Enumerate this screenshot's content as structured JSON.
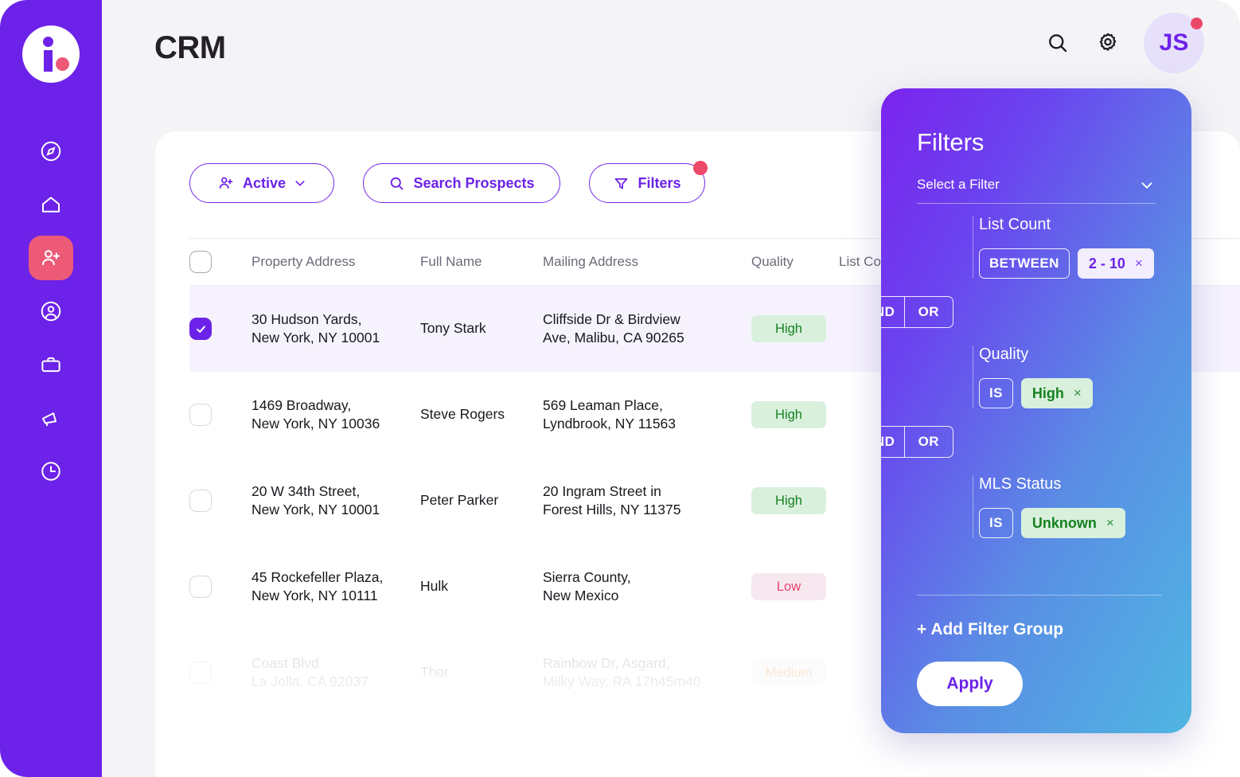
{
  "app": {
    "logo_name": "company-logo",
    "brand_purple": "#6c22e8",
    "accent_pink": "#ec4868"
  },
  "sidebar": {
    "items": [
      {
        "icon": "compass-icon",
        "label": "Explore",
        "active": false
      },
      {
        "icon": "home-icon",
        "label": "Home",
        "active": false
      },
      {
        "icon": "add-user-icon",
        "label": "Prospects",
        "active": true
      },
      {
        "icon": "user-circle-icon",
        "label": "Contacts",
        "active": false
      },
      {
        "icon": "briefcase-icon",
        "label": "Deals",
        "active": false
      },
      {
        "icon": "megaphone-icon",
        "label": "Campaigns",
        "active": false
      },
      {
        "icon": "clock-icon",
        "label": "Activity",
        "active": false
      }
    ]
  },
  "header": {
    "title": "CRM",
    "search_icon": "search-icon",
    "settings_icon": "gear-icon",
    "avatar_initials": "JS"
  },
  "toolbar": {
    "active_label": "Active",
    "search_label": "Search Prospects",
    "filters_label": "Filters",
    "filters_has_badge": true
  },
  "table": {
    "columns": [
      "Property Address",
      "Full Name",
      "Mailing Address",
      "Quality",
      "List Cou"
    ],
    "rows": [
      {
        "selected": true,
        "address_line1": "30 Hudson Yards,",
        "address_line2": "New York, NY 10001",
        "full_name": "Tony Stark",
        "mailing_line1": "Cliffside Dr & Birdview",
        "mailing_line2": "Ave, Malibu, CA 90265",
        "quality": "High",
        "quality_tone": "high"
      },
      {
        "selected": false,
        "address_line1": "1469 Broadway,",
        "address_line2": "New York, NY 10036",
        "full_name": "Steve Rogers",
        "mailing_line1": "569 Leaman Place,",
        "mailing_line2": "Lyndbrook, NY 11563",
        "quality": "High",
        "quality_tone": "high"
      },
      {
        "selected": false,
        "address_line1": "20 W 34th Street,",
        "address_line2": "New York, NY 10001",
        "full_name": "Peter Parker",
        "mailing_line1": "20 Ingram Street in",
        "mailing_line2": "Forest Hills, NY 11375",
        "quality": "High",
        "quality_tone": "high"
      },
      {
        "selected": false,
        "address_line1": "45 Rockefeller Plaza,",
        "address_line2": "New York, NY 10111",
        "full_name": "Hulk",
        "mailing_line1": "Sierra County,",
        "mailing_line2": "New Mexico",
        "quality": "Low",
        "quality_tone": "low"
      },
      {
        "selected": false,
        "address_line1": "Coast Blvd",
        "address_line2": "La Jolla, CA 92037",
        "full_name": "Thor",
        "mailing_line1": "Rainbow Dr, Asgard,",
        "mailing_line2": "Milky Way, RA 17h45m40",
        "quality": "Medium",
        "quality_tone": "medium"
      }
    ]
  },
  "filters": {
    "title": "Filters",
    "select_placeholder": "Select a Filter",
    "groups": [
      {
        "label": "List Count",
        "operator": "BETWEEN",
        "value": "2 - 10",
        "value_tone": "violet",
        "remove_label": "×"
      },
      {
        "label": "Quality",
        "operator": "IS",
        "value": "High",
        "value_tone": "green",
        "remove_label": "×"
      },
      {
        "label": "MLS Status",
        "operator": "IS",
        "value": "Unknown",
        "value_tone": "green",
        "remove_label": "×"
      }
    ],
    "joins": [
      {
        "and_label": "AND",
        "or_label": "OR"
      },
      {
        "and_label": "AND",
        "or_label": "OR"
      }
    ],
    "add_group_label": "+ Add Filter Group",
    "apply_label": "Apply"
  }
}
